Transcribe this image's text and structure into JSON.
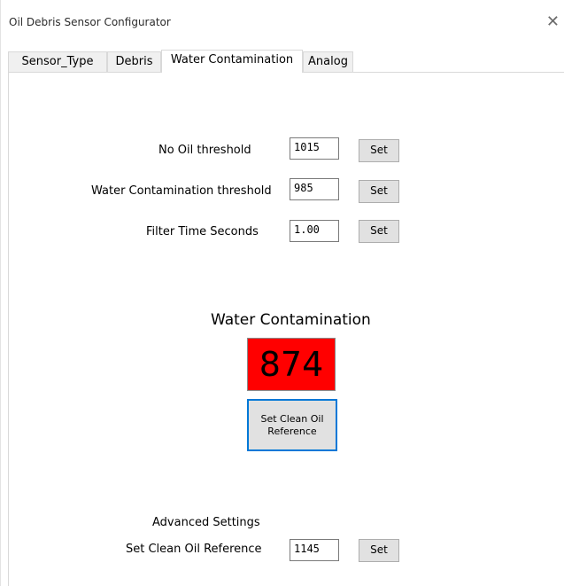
{
  "window": {
    "title": "Oil Debris Sensor Configurator",
    "close_glyph": "✕"
  },
  "tabs": [
    {
      "label": "Sensor_Type",
      "active": false
    },
    {
      "label": "Debris",
      "active": false
    },
    {
      "label": "Water Contamination",
      "active": true
    },
    {
      "label": "Analog",
      "active": false
    }
  ],
  "settings": {
    "no_oil": {
      "label": "No Oil threshold",
      "value": "1015",
      "button": "Set"
    },
    "water_threshold": {
      "label": "Water Contamination threshold",
      "value": "985",
      "button": "Set"
    },
    "filter_time": {
      "label": "Filter Time Seconds",
      "value": "1.00",
      "button": "Set"
    }
  },
  "status": {
    "heading": "Water Contamination",
    "reading": "874",
    "reading_color": "#ff0000",
    "reference_button_line1": "Set Clean Oil",
    "reference_button_line2": "Reference"
  },
  "advanced": {
    "heading": "Advanced Settings",
    "label": "Set Clean Oil Reference",
    "value": "1145",
    "button": "Set"
  },
  "colors": {
    "accent_focus": "#0078d7"
  }
}
